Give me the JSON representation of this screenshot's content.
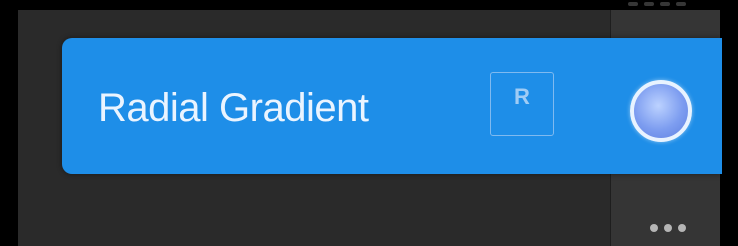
{
  "tool": {
    "label": "Radial Gradient",
    "shortcut": "R",
    "icon": "radial-gradient-icon",
    "accent_color": "#1e8ee8"
  },
  "panel": {
    "overflow_icon": "ellipsis-icon"
  }
}
